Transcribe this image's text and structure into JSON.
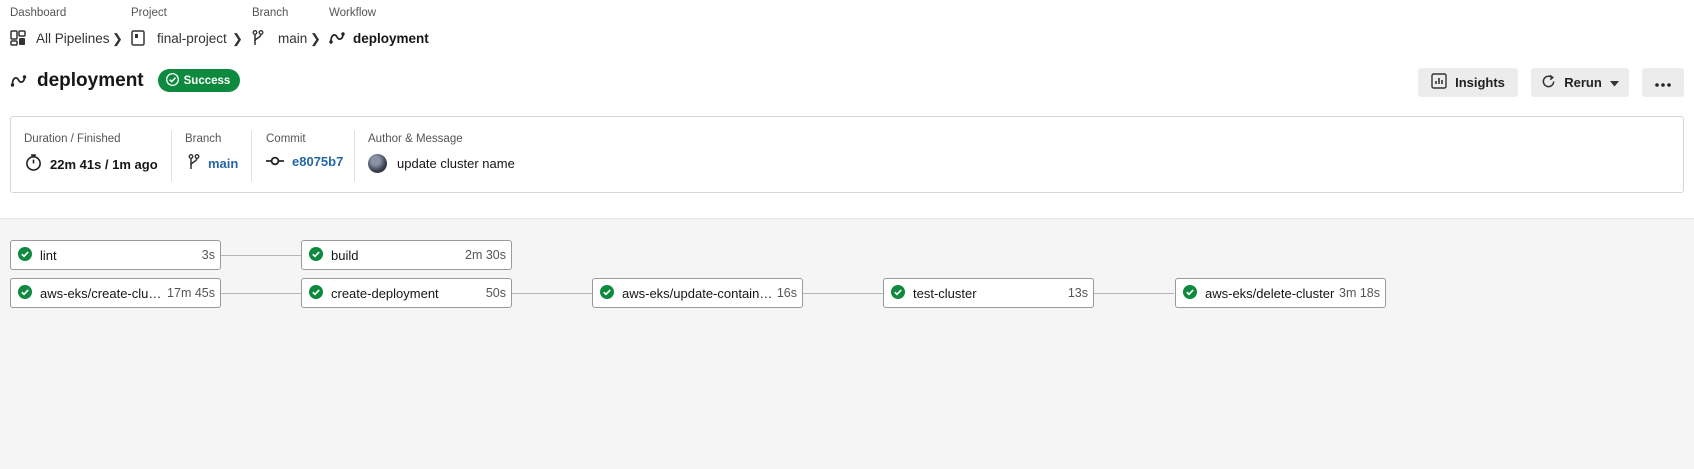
{
  "breadcrumb": {
    "dashboard": {
      "label": "Dashboard",
      "value": "All Pipelines"
    },
    "project": {
      "label": "Project",
      "value": "final-project"
    },
    "branch": {
      "label": "Branch",
      "value": "main"
    },
    "workflow": {
      "label": "Workflow",
      "value": "deployment"
    }
  },
  "header": {
    "title": "deployment",
    "status": "Success",
    "status_color": "#0e8a3e",
    "insights_label": "Insights",
    "rerun_label": "Rerun"
  },
  "summary": {
    "duration": {
      "label": "Duration / Finished",
      "value": "22m 41s / 1m ago"
    },
    "branch": {
      "label": "Branch",
      "value": "main"
    },
    "commit": {
      "label": "Commit",
      "value": "e8075b7"
    },
    "author": {
      "label": "Author & Message",
      "value": "update cluster name"
    }
  },
  "jobs": [
    {
      "name": "lint",
      "duration": "3s",
      "status": "success"
    },
    {
      "name": "build",
      "duration": "2m 30s",
      "status": "success"
    },
    {
      "name": "aws-eks/create-cluster",
      "duration": "17m 45s",
      "status": "success"
    },
    {
      "name": "create-deployment",
      "duration": "50s",
      "status": "success"
    },
    {
      "name": "aws-eks/update-container-image",
      "duration": "16s",
      "status": "success"
    },
    {
      "name": "test-cluster",
      "duration": "13s",
      "status": "success"
    },
    {
      "name": "aws-eks/delete-cluster",
      "duration": "3m 18s",
      "status": "success"
    }
  ],
  "icons": {
    "dashboard": "dashboard-icon",
    "project": "project-icon",
    "branch": "branch-icon",
    "workflow": "workflow-icon",
    "insights": "chart-icon",
    "rerun": "refresh-icon",
    "more": "more-icon",
    "timer": "timer-icon",
    "commit": "commit-icon",
    "success": "check-circle-icon"
  },
  "colors": {
    "success": "#0e8a3e",
    "link": "#2767a8"
  }
}
